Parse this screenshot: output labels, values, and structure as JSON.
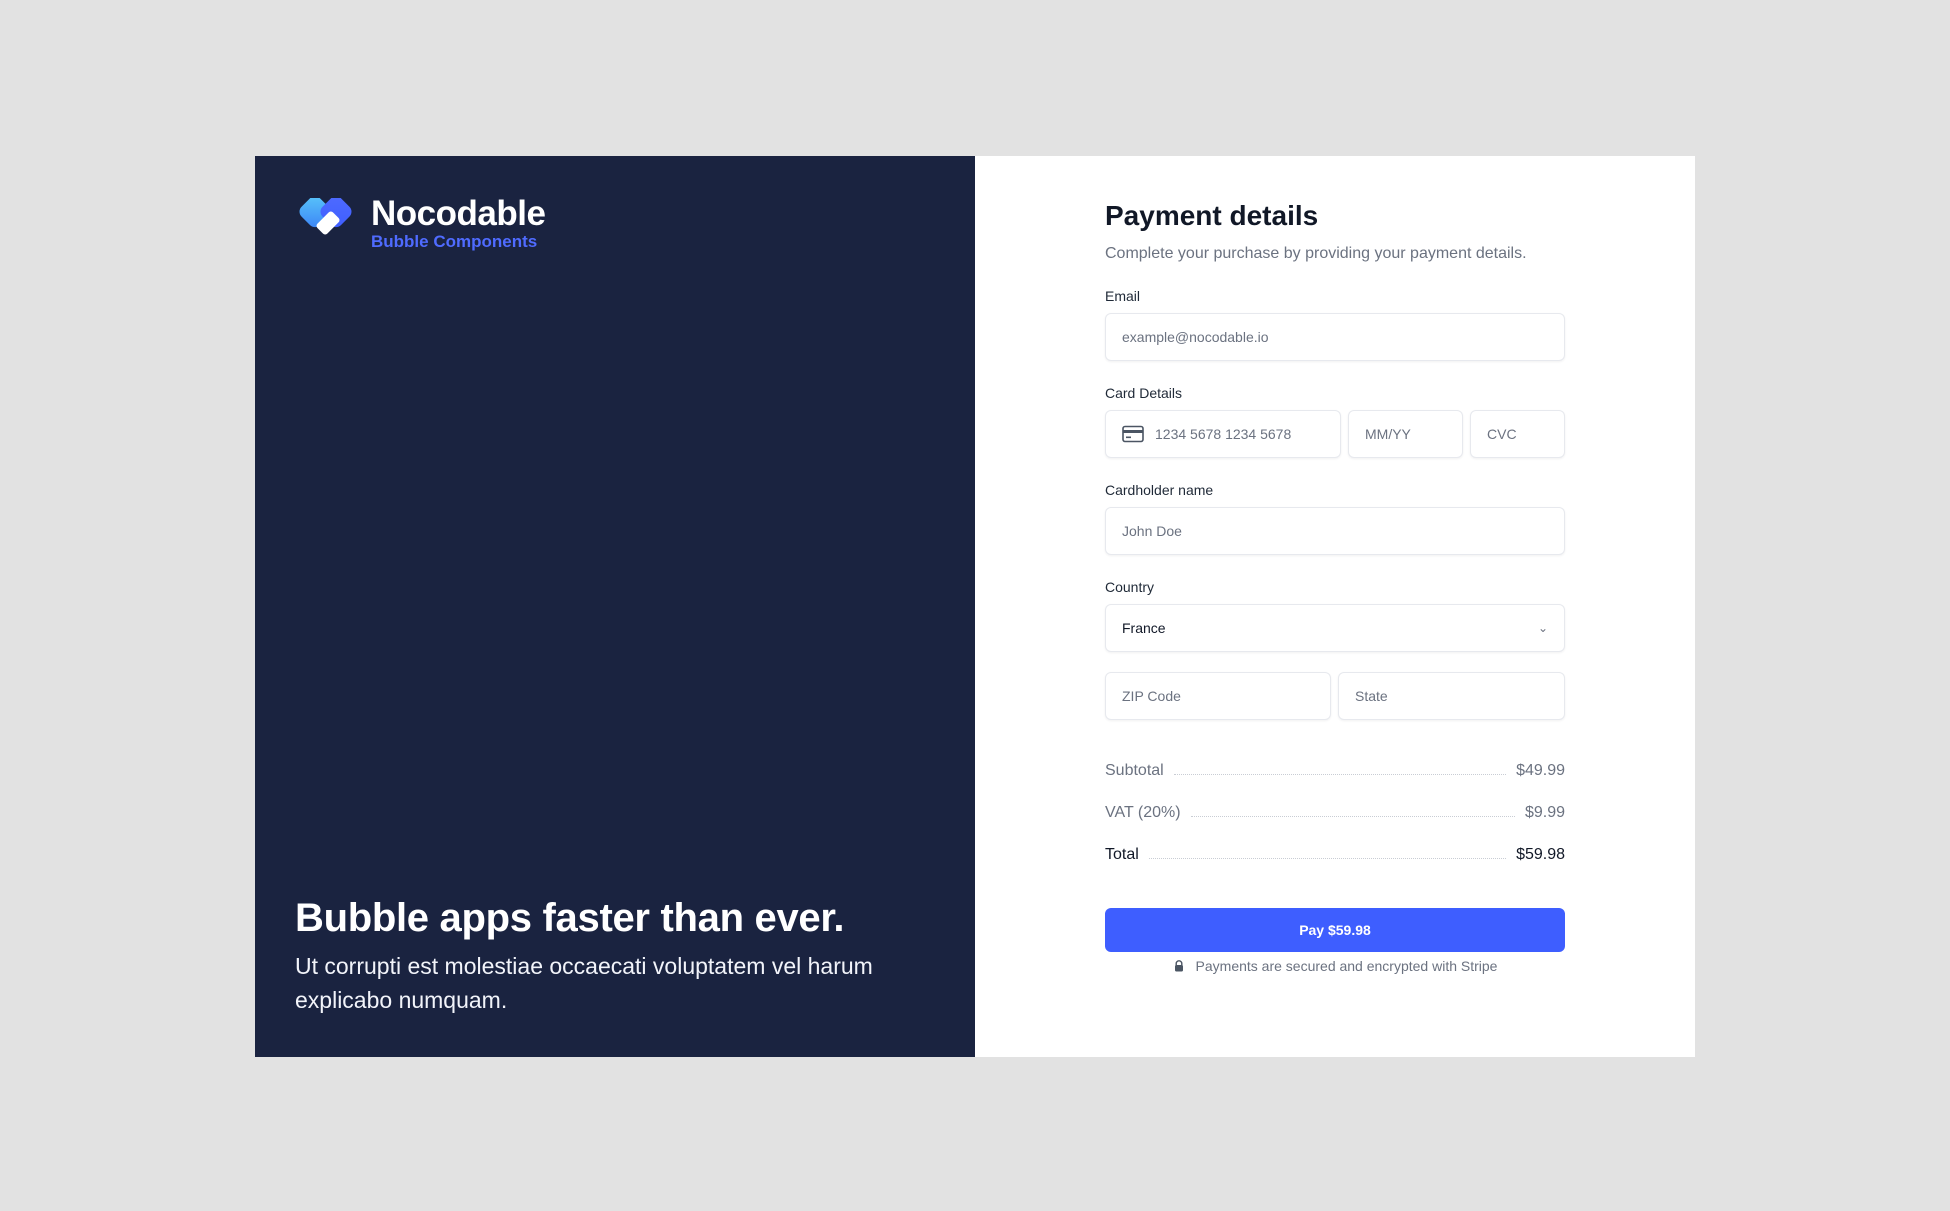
{
  "brand": {
    "name": "Nocodable",
    "subtitle": "Bubble Components"
  },
  "hero": {
    "title": "Bubble apps faster than ever.",
    "text": "Ut corrupti est molestiae occaecati voluptatem vel harum explicabo numquam."
  },
  "form": {
    "title": "Payment details",
    "subtitle": "Complete your purchase by providing your payment details.",
    "email": {
      "label": "Email",
      "placeholder": "example@nocodable.io"
    },
    "card": {
      "label": "Card Details",
      "number_placeholder": "1234 5678 1234 5678",
      "expiry_placeholder": "MM/YY",
      "cvc_placeholder": "CVC",
      "icon": "credit-card-icon"
    },
    "cardholder": {
      "label": "Cardholder name",
      "placeholder": "John Doe"
    },
    "country": {
      "label": "Country",
      "value": "France",
      "icon": "chevron-down-icon"
    },
    "zip": {
      "placeholder": "ZIP Code"
    },
    "state": {
      "placeholder": "State"
    }
  },
  "summary": {
    "subtotal_label": "Subtotal",
    "subtotal_value": "$49.99",
    "vat_label": "VAT (20%)",
    "vat_value": "$9.99",
    "total_label": "Total",
    "total_value": "$59.98"
  },
  "pay": {
    "button_label": "Pay $59.98",
    "secure_note": "Payments are secured and encrypted with Stripe",
    "lock_icon": "lock-icon"
  },
  "colors": {
    "left_panel_bg": "#1a2340",
    "accent": "#3e5eff",
    "brand_sub": "#4f6bff",
    "page_bg": "#e2e2e2"
  }
}
